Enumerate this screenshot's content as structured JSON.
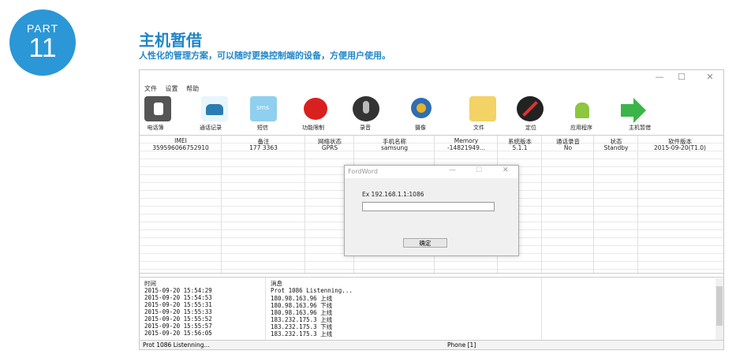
{
  "badge": {
    "part": "PART",
    "number": "11"
  },
  "heading": {
    "title": "主机暂借",
    "subtitle": "人性化的管理方案，可以随时更换控制端的设备，方便用户使用。"
  },
  "window": {
    "menu": [
      "文件",
      "设置",
      "帮助"
    ],
    "toolbar": [
      {
        "label": "电话簿",
        "icon": "contacts-icon"
      },
      {
        "label": "通话记录",
        "icon": "phone-icon"
      },
      {
        "label": "短信",
        "icon": "sms-icon"
      },
      {
        "label": "功能限制",
        "icon": "sms-block-icon"
      },
      {
        "label": "录音",
        "icon": "microphone-icon"
      },
      {
        "label": "摄像",
        "icon": "webcam-icon"
      },
      {
        "label": "文件",
        "icon": "folder-icon"
      },
      {
        "label": "定位",
        "icon": "compass-icon"
      },
      {
        "label": "应用程序",
        "icon": "android-icon"
      },
      {
        "label": "主机暂借",
        "icon": "arrow-icon"
      }
    ],
    "columns": [
      "IMEI",
      "备注",
      "网络状态",
      "手机名称",
      "Memory",
      "系统版本",
      "通话录音",
      "状态",
      "软件版本"
    ],
    "row": [
      "359596066752910",
      "177    3363",
      "GPRS",
      "samsung",
      "-14821949...",
      "5.1.1",
      "No",
      "Standby",
      "2015-09-20(T1.0)"
    ],
    "log_headers": [
      "时间",
      "消息"
    ],
    "log": [
      [
        "2015-09-20 15:54:29",
        "Prot 1086 Listenning..."
      ],
      [
        "2015-09-20 15:54:53",
        "180.98.163.96  上线"
      ],
      [
        "2015-09-20 15:55:31",
        "180.98.163.96  下线"
      ],
      [
        "2015-09-20 15:55:33",
        "180.98.163.96  上线"
      ],
      [
        "2015-09-20 15:55:52",
        "183.232.175.3  上线"
      ],
      [
        "2015-09-20 15:55:57",
        "183.232.175.3  下线"
      ],
      [
        "2015-09-20 15:56:05",
        "183.232.175.3  上线"
      ]
    ],
    "status_left": "Prot 1086 Listenning...",
    "status_right": "Phone [1]"
  },
  "dialog": {
    "title": "FordWord",
    "label": "Ex 192.168.1.1:1086",
    "input_value": "",
    "ok": "确定"
  },
  "colors": {
    "brand": "#2b97d6"
  }
}
